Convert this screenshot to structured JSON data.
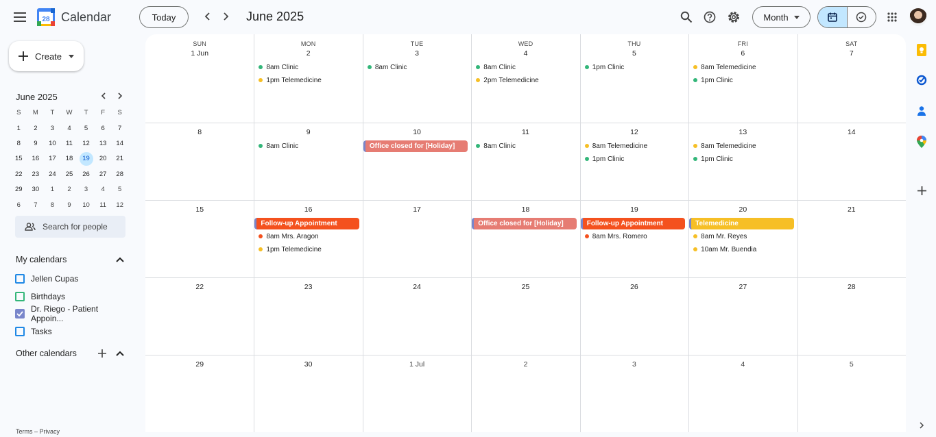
{
  "app": {
    "name": "Calendar",
    "logo_day": "28"
  },
  "header": {
    "today_label": "Today",
    "period": "June 2025",
    "view": "Month"
  },
  "sidebar": {
    "create_label": "Create",
    "mini": {
      "title": "June 2025",
      "dow": [
        "S",
        "M",
        "T",
        "W",
        "T",
        "F",
        "S"
      ],
      "weeks": [
        [
          "1",
          "2",
          "3",
          "4",
          "5",
          "6",
          "7"
        ],
        [
          "8",
          "9",
          "10",
          "11",
          "12",
          "13",
          "14"
        ],
        [
          "15",
          "16",
          "17",
          "18",
          "19",
          "20",
          "21"
        ],
        [
          "22",
          "23",
          "24",
          "25",
          "26",
          "27",
          "28"
        ],
        [
          "29",
          "30",
          "1",
          "2",
          "3",
          "4",
          "5"
        ],
        [
          "6",
          "7",
          "8",
          "9",
          "10",
          "11",
          "12"
        ]
      ],
      "selected": "19"
    },
    "search_people": "Search for people",
    "my_calendars_title": "My calendars",
    "my_calendars": [
      {
        "label": "Jellen Cupas",
        "color": "#1e88e5",
        "checked": false
      },
      {
        "label": "Birthdays",
        "color": "#33b679",
        "checked": false
      },
      {
        "label": "Dr. Riego - Patient Appoin...",
        "color": "#7986cb",
        "checked": true
      },
      {
        "label": "Tasks",
        "color": "#1e88e5",
        "checked": false
      }
    ],
    "other_calendars_title": "Other calendars",
    "footer": "Terms – Privacy"
  },
  "month": {
    "weekdays": [
      "SUN",
      "MON",
      "TUE",
      "WED",
      "THU",
      "FRI",
      "SAT"
    ],
    "weeks": [
      [
        {
          "label": "1 Jun",
          "events": []
        },
        {
          "label": "2",
          "events": [
            {
              "text": "8am Clinic",
              "color": "#33b679"
            },
            {
              "text": "1pm Telemedicine",
              "color": "#f6bf26"
            }
          ]
        },
        {
          "label": "3",
          "events": [
            {
              "text": "8am Clinic",
              "color": "#33b679"
            }
          ]
        },
        {
          "label": "4",
          "events": [
            {
              "text": "8am Clinic",
              "color": "#33b679"
            },
            {
              "text": "2pm Telemedicine",
              "color": "#f6bf26"
            }
          ]
        },
        {
          "label": "5",
          "events": [
            {
              "text": "1pm Clinic",
              "color": "#33b679"
            }
          ]
        },
        {
          "label": "6",
          "events": [
            {
              "text": "8am Telemedicine",
              "color": "#f6bf26"
            },
            {
              "text": "1pm Clinic",
              "color": "#33b679"
            }
          ]
        },
        {
          "label": "7",
          "events": []
        }
      ],
      [
        {
          "label": "8",
          "events": []
        },
        {
          "label": "9",
          "events": [
            {
              "text": "8am Clinic",
              "color": "#33b679"
            }
          ]
        },
        {
          "label": "10",
          "events": [],
          "chip": {
            "text": "Office closed for [Holiday]",
            "color": "#e67c73"
          }
        },
        {
          "label": "11",
          "events": [
            {
              "text": "8am Clinic",
              "color": "#33b679"
            }
          ]
        },
        {
          "label": "12",
          "events": [
            {
              "text": "8am Telemedicine",
              "color": "#f6bf26"
            },
            {
              "text": "1pm Clinic",
              "color": "#33b679"
            }
          ]
        },
        {
          "label": "13",
          "events": [
            {
              "text": "8am Telemedicine",
              "color": "#f6bf26"
            },
            {
              "text": "1pm Clinic",
              "color": "#33b679"
            }
          ]
        },
        {
          "label": "14",
          "events": []
        }
      ],
      [
        {
          "label": "15",
          "events": []
        },
        {
          "label": "16",
          "events": [
            {
              "text": "8am Mrs. Aragon",
              "color": "#f4511e"
            },
            {
              "text": "1pm Telemedicine",
              "color": "#f6bf26"
            }
          ],
          "chip": {
            "text": "Follow-up Appointment",
            "color": "#f4511e"
          }
        },
        {
          "label": "17",
          "events": []
        },
        {
          "label": "18",
          "events": [],
          "chip": {
            "text": "Office closed for [Holiday]",
            "color": "#e67c73"
          }
        },
        {
          "label": "19",
          "events": [
            {
              "text": "8am Mrs. Romero",
              "color": "#f4511e"
            }
          ],
          "chip": {
            "text": "Follow-up Appointment",
            "color": "#f4511e"
          }
        },
        {
          "label": "20",
          "events": [
            {
              "text": "8am Mr. Reyes",
              "color": "#f6bf26"
            },
            {
              "text": "10am Mr. Buendia",
              "color": "#f6bf26"
            }
          ],
          "chip": {
            "text": "Telemedicine",
            "color": "#f6bf26"
          }
        },
        {
          "label": "21",
          "events": []
        }
      ],
      [
        {
          "label": "22",
          "events": []
        },
        {
          "label": "23",
          "events": []
        },
        {
          "label": "24",
          "events": []
        },
        {
          "label": "25",
          "events": []
        },
        {
          "label": "26",
          "events": []
        },
        {
          "label": "27",
          "events": []
        },
        {
          "label": "28",
          "events": []
        }
      ],
      [
        {
          "label": "29",
          "events": []
        },
        {
          "label": "30",
          "events": []
        },
        {
          "label": "1 Jul",
          "events": [],
          "other_month": true
        },
        {
          "label": "2",
          "events": [],
          "other_month": true
        },
        {
          "label": "3",
          "events": [],
          "other_month": true
        },
        {
          "label": "4",
          "events": [],
          "other_month": true
        },
        {
          "label": "5",
          "events": [],
          "other_month": true
        }
      ]
    ]
  },
  "right_rail": [
    "keep-icon",
    "tasks-icon",
    "contacts-icon",
    "maps-icon",
    "add-icon"
  ]
}
